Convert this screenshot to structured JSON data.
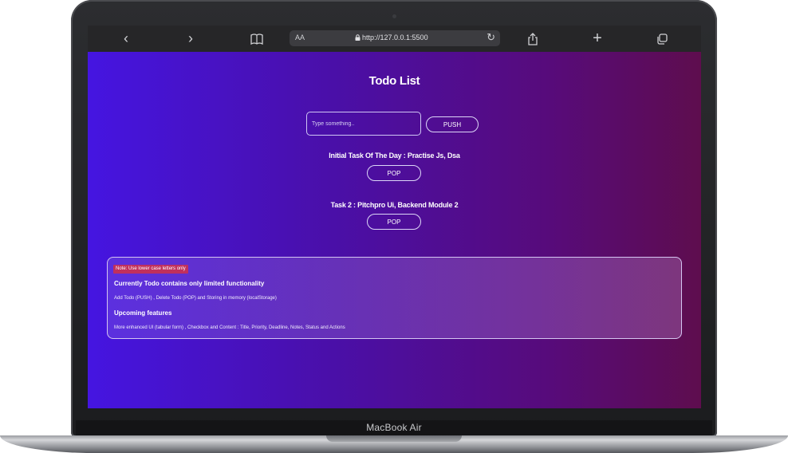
{
  "device": {
    "label": "MacBook Air"
  },
  "browser": {
    "back_icon": "‹",
    "forward_icon": "›",
    "reader_aa": "AA",
    "url": "http://127.0.0.1:5500",
    "lock_icon": "lock-icon",
    "reload_icon": "↻",
    "new_tab_icon": "+"
  },
  "app": {
    "title": "Todo List",
    "input_placeholder": "Type something..",
    "push_label": "PUSH",
    "tasks": [
      {
        "text": "Initial Task Of The Day : Practise Js, Dsa",
        "pop_label": "POP"
      },
      {
        "text": "Task 2 : Pitchpro Ui, Backend Module 2",
        "pop_label": "POP"
      }
    ],
    "note": {
      "badge": "Note: Use lower case letters only",
      "heading1": "Currently Todo contains only limited functionality",
      "line1": "Add Todo (PUSH) , Delete Todo (POP) and Storing in memory (localStorage)",
      "heading2": "Upcoming features",
      "line2": "More enhanced UI (tabular form) , Checkbox and Content : Title, Priority, Deadline, Notes, Status and Actions"
    }
  },
  "colors": {
    "page_gradient_start": "#4515e1",
    "page_gradient_end": "#5e0d4e",
    "badge": "#c0305d"
  }
}
